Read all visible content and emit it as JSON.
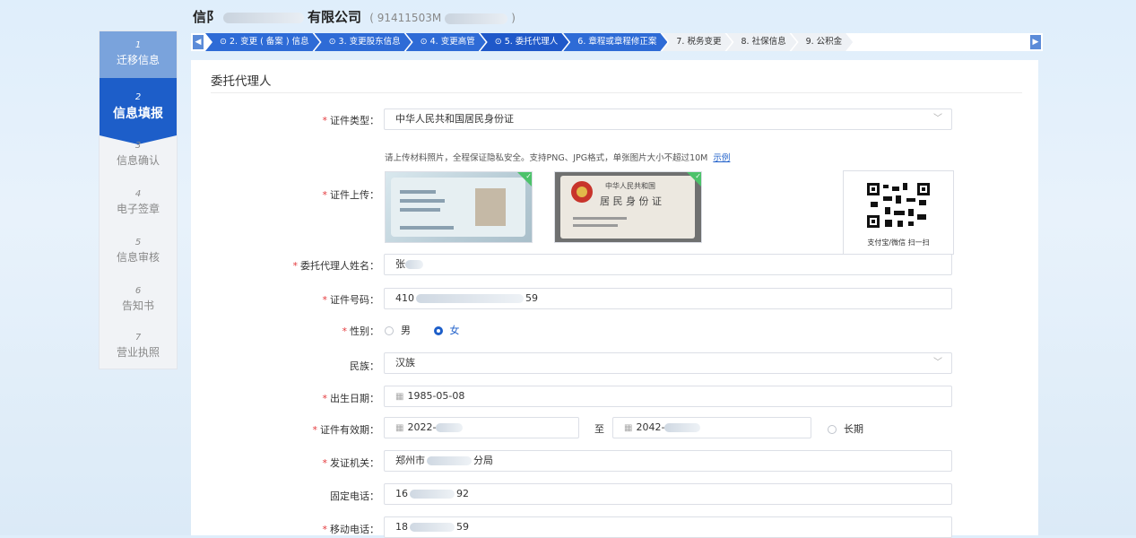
{
  "header": {
    "company_prefix": "信阝",
    "company_suffix": "有限公司",
    "credit_code": "( 91411503M",
    "credit_code_end": ")"
  },
  "steps": [
    {
      "label": "⊙ 2. 变更 ( 备案 ) 信息",
      "state": "done"
    },
    {
      "label": "⊙ 3. 变更股东信息",
      "state": "done"
    },
    {
      "label": "⊙ 4. 变更高管",
      "state": "done"
    },
    {
      "label": "⊙ 5. 委托代理人",
      "state": "active"
    },
    {
      "label": "6. 章程或章程修正案",
      "state": "done"
    },
    {
      "label": "7. 税务变更",
      "state": "todo"
    },
    {
      "label": "8. 社保信息",
      "state": "todo"
    },
    {
      "label": "9. 公积金",
      "state": "todo"
    }
  ],
  "sidebar": [
    {
      "num": "1",
      "label": "迁移信息",
      "state": "done"
    },
    {
      "num": "2",
      "label": "信息填报",
      "state": "active"
    },
    {
      "num": "3",
      "label": "信息确认",
      "state": "todo"
    },
    {
      "num": "4",
      "label": "电子签章",
      "state": "todo"
    },
    {
      "num": "5",
      "label": "信息审核",
      "state": "todo"
    },
    {
      "num": "6",
      "label": "告知书",
      "state": "todo"
    },
    {
      "num": "7",
      "label": "营业执照",
      "state": "todo"
    }
  ],
  "form": {
    "title": "委托代理人",
    "id_type": {
      "label": "证件类型：",
      "value": "中华人民共和国居民身份证"
    },
    "upload": {
      "label": "证件上传：",
      "hint": "请上传材料照片，全程保证隐私安全。支持PNG、JPG格式，单张图片大小不超过10M",
      "example": "示例",
      "front_title": "中华人民共和国",
      "front_sub": "居 民 身 份 证",
      "qr_caption": "支付宝/微信 扫一扫"
    },
    "name": {
      "label": "委托代理人姓名：",
      "value": "张"
    },
    "id_number": {
      "label": "证件号码：",
      "value_start": "410",
      "value_end": "59"
    },
    "gender": {
      "label": "性别：",
      "male": "男",
      "female": "女",
      "selected": "女"
    },
    "ethnicity": {
      "label": "民族：",
      "value": "汉族"
    },
    "birth_date": {
      "label": "出生日期：",
      "value": "1985-05-08"
    },
    "validity": {
      "label": "证件有效期：",
      "start": "2022-",
      "to": "至",
      "end": "2042-",
      "long_term": "长期"
    },
    "issuer": {
      "label": "发证机关：",
      "value_start": "郑州市",
      "value_end": "分局"
    },
    "landline": {
      "label": "固定电话：",
      "value_start": "16",
      "value_end": "92"
    },
    "mobile": {
      "label": "移动电话：",
      "value_start": "18",
      "value_end": "59"
    }
  },
  "colors": {
    "accent": "#1d5ec9",
    "required": "#e4393c",
    "done_check": "#4cc26a"
  }
}
